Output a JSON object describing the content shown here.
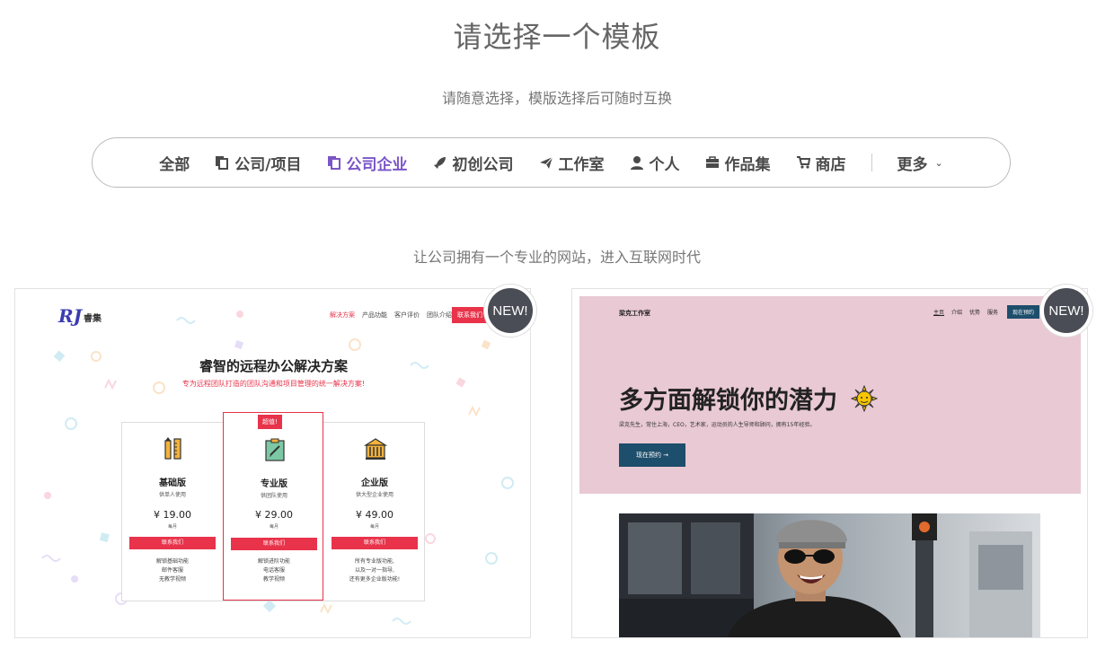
{
  "header": {
    "title": "请选择一个模板",
    "subtitle": "请随意选择，模版选择后可随时互换"
  },
  "filters": {
    "items": [
      {
        "label": "全部",
        "icon": "none"
      },
      {
        "label": "公司/项目",
        "icon": "copy-icon"
      },
      {
        "label": "公司企业",
        "icon": "copy-icon",
        "active": true
      },
      {
        "label": "初创公司",
        "icon": "rocket-icon"
      },
      {
        "label": "工作室",
        "icon": "paper-plane-icon"
      },
      {
        "label": "个人",
        "icon": "user-icon"
      },
      {
        "label": "作品集",
        "icon": "briefcase-icon"
      },
      {
        "label": "商店",
        "icon": "cart-icon"
      }
    ],
    "more_label": "更多",
    "active_color": "#7a55c7"
  },
  "section": {
    "description": "让公司拥有一个专业的网站，进入互联网时代"
  },
  "templates": [
    {
      "badge": "NEW!",
      "preview": {
        "logo": "RJ",
        "brand": "睿集",
        "nav": [
          "解决方案",
          "产品功能",
          "客户评价",
          "团队介绍"
        ],
        "cta": "联系我们",
        "hero_title": "睿智的远程办公解决方案",
        "hero_sub": "专为远程团队打造的团队沟通和项目管理的统一解决方案!",
        "featured_tag": "超值!",
        "plans": [
          {
            "name": "基础版",
            "note": "供单人使用",
            "price": "¥ 19.00",
            "per": "每月",
            "button": "联系我们",
            "features": [
              "解锁基础功能",
              "邮件客服",
              "无教学视频"
            ]
          },
          {
            "name": "专业版",
            "note": "供团队使用",
            "price": "¥ 29.00",
            "per": "每月",
            "button": "联系我们",
            "features": [
              "解锁进阶功能",
              "电话客服",
              "教学视频"
            ]
          },
          {
            "name": "企业版",
            "note": "供大型企业使用",
            "price": "¥ 49.00",
            "per": "每月",
            "button": "联系我们",
            "features": [
              "所有专业版功能,",
              "以及一对一指导,",
              "还有更多企业版功能!"
            ]
          }
        ],
        "accent": "#e8334a"
      }
    },
    {
      "badge": "NEW!",
      "preview": {
        "brand": "梁克工作室",
        "nav": [
          "主页",
          "介绍",
          "优势",
          "服务"
        ],
        "cta": "现在预约",
        "hero_title": "多方面解锁你的潜力",
        "hero_desc": "梁克先生，常住上海，CEO，艺术家，运动员的人生导师和顾问，拥有15年经验。",
        "button": "现在预约 →",
        "hero_bg": "#e9c9d3",
        "accent": "#1d4e6b"
      }
    }
  ]
}
